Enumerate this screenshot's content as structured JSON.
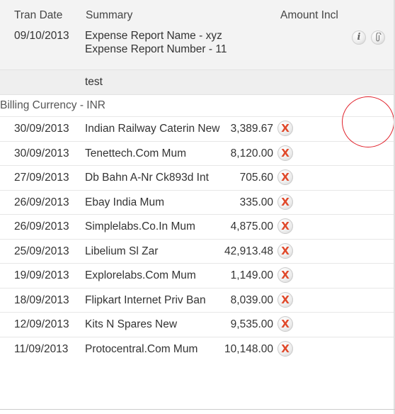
{
  "header": {
    "tran_date": "Tran Date",
    "summary": "Summary",
    "amount": "Amount Incl"
  },
  "expense_report": {
    "date": "09/10/2013",
    "name_line": "Expense Report Name - xyz",
    "number_line": "Expense Report Number - 11",
    "note": "test",
    "info_icon": "info-icon",
    "attachment_icon": "paperclip-icon"
  },
  "billing_currency": "Billing Currency - INR",
  "delete_glyph": "X",
  "transactions": [
    {
      "date": "30/09/2013",
      "summary": "Indian Railway Caterin New",
      "amount": "3,389.67"
    },
    {
      "date": "30/09/2013",
      "summary": "Tenettech.Com Mum",
      "amount": "8,120.00"
    },
    {
      "date": "27/09/2013",
      "summary": "Db Bahn A-Nr Ck893d Int",
      "amount": "705.60"
    },
    {
      "date": "26/09/2013",
      "summary": "Ebay India Mum",
      "amount": "335.00"
    },
    {
      "date": "26/09/2013",
      "summary": "Simplelabs.Co.In Mum",
      "amount": "4,875.00"
    },
    {
      "date": "25/09/2013",
      "summary": "Libelium Sl Zar",
      "amount": "42,913.48"
    },
    {
      "date": "19/09/2013",
      "summary": "Explorelabs.Com Mum",
      "amount": "1,149.00"
    },
    {
      "date": "18/09/2013",
      "summary": "Flipkart Internet Priv Ban",
      "amount": "8,039.00"
    },
    {
      "date": "12/09/2013",
      "summary": "Kits N Spares New",
      "amount": "9,535.00"
    },
    {
      "date": "11/09/2013",
      "summary": "Protocentral.Com Mum",
      "amount": "10,148.00"
    }
  ],
  "colors": {
    "delete_x": "#e0492b",
    "annotation_circle": "#e0202a",
    "header_bg": "#f3f3f3"
  }
}
